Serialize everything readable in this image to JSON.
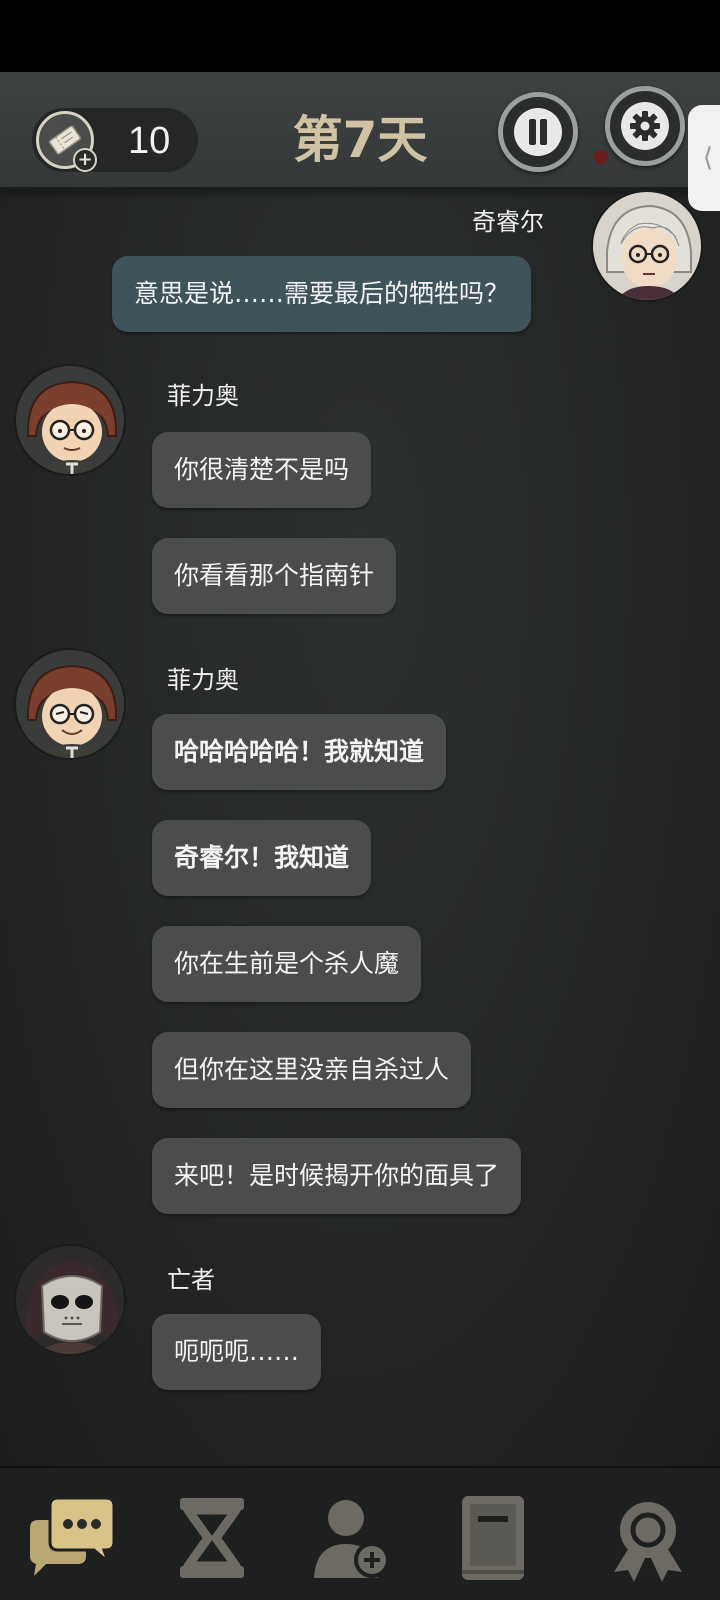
{
  "header": {
    "ticket_count": "10",
    "day_title": "第7天",
    "accent_color": "#cfc3a3"
  },
  "messages": [
    {
      "speaker": "奇睿尔",
      "side": "right",
      "texts": [
        "意思是说……需要最后的牺牲吗？"
      ]
    },
    {
      "speaker": "菲力奥",
      "side": "left",
      "texts": [
        "你很清楚不是吗",
        "你看看那个指南针"
      ]
    },
    {
      "speaker": "菲力奥",
      "side": "left",
      "texts": [
        "哈哈哈哈哈！我就知道",
        "奇睿尔！我知道",
        "你在生前是个杀人魔",
        "但你在这里没亲自杀过人",
        "来吧！是时候揭开你的面具了"
      ]
    },
    {
      "speaker": "亡者",
      "side": "left",
      "texts": [
        "呃呃呃……"
      ]
    }
  ],
  "icons": {
    "ticket": "ticket-icon",
    "pause": "pause-icon",
    "settings": "gear-icon",
    "side_tab": "chevron-left-icon"
  },
  "bottom_nav": [
    "chat-icon",
    "hourglass-icon",
    "add-friend-icon",
    "book-icon",
    "achievement-icon"
  ],
  "colors": {
    "bubble_other": "#4b4c4c",
    "bubble_mine": "#3e535a",
    "nav_active": "#cdb985",
    "nav_inactive": "#6c6a63"
  }
}
